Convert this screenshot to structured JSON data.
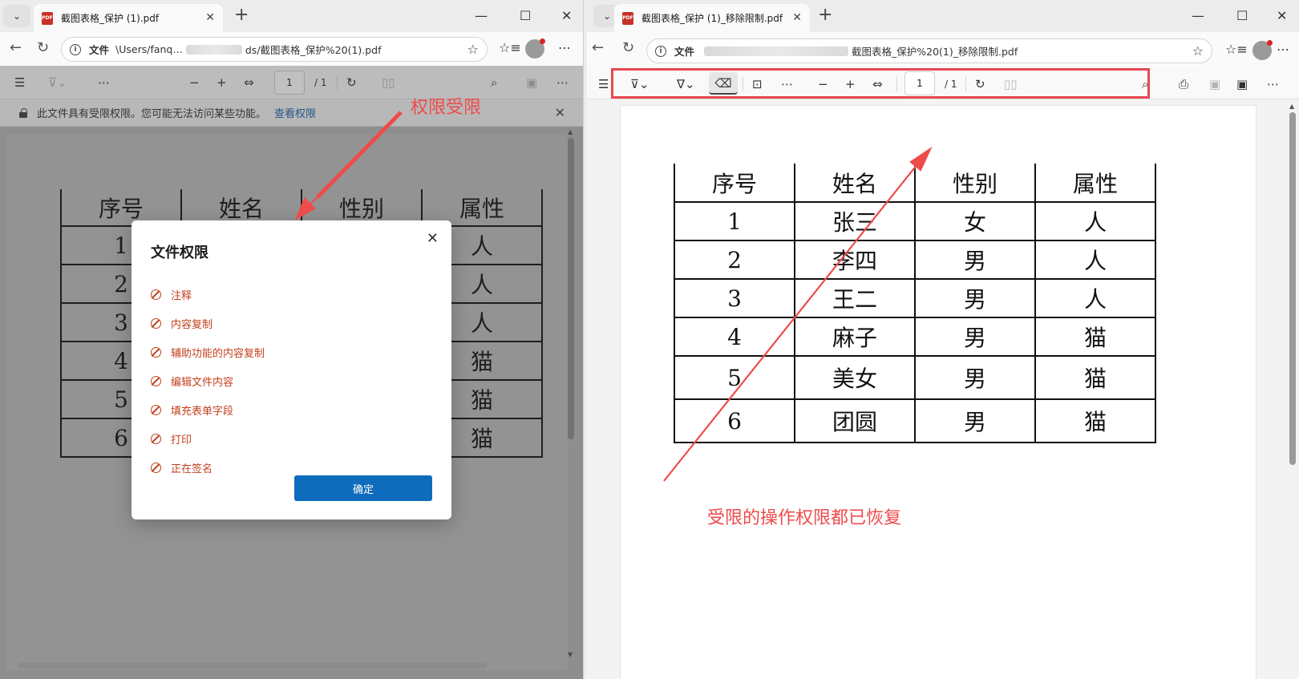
{
  "left_window": {
    "tab_title": "截图表格_保护 (1).pdf",
    "tab_close": "✕",
    "new_tab": "+",
    "window_controls": {
      "minimize": "—",
      "maximize": "☐",
      "close": "✕"
    },
    "address": {
      "scheme_label": "文件",
      "path_visible_start": "\\Users/fanq…",
      "path_visible_end": "ds/截图表格_保护%20(1).pdf"
    },
    "pdf_toolbar": {
      "page_current": "1",
      "page_total": "/ 1"
    },
    "restriction_bar": {
      "message": "此文件具有受限权限。您可能无法访问某些功能。",
      "link": "查看权限",
      "close": "✕"
    },
    "table": {
      "headers": [
        "序号",
        "姓名",
        "性别",
        "属性"
      ],
      "rows": [
        [
          "1",
          "",
          "",
          "人"
        ],
        [
          "2",
          "",
          "",
          "人"
        ],
        [
          "3",
          "",
          "",
          "人"
        ],
        [
          "4",
          "",
          "",
          "猫"
        ],
        [
          "5",
          "",
          "",
          "猫"
        ],
        [
          "6",
          "",
          "",
          "猫"
        ]
      ]
    },
    "dialog": {
      "title": "文件权限",
      "close": "✕",
      "permissions": [
        "注释",
        "内容复制",
        "辅助功能的内容复制",
        "编辑文件内容",
        "填充表单字段",
        "打印",
        "正在签名"
      ],
      "ok_button": "确定"
    }
  },
  "right_window": {
    "tab_title": "截图表格_保护 (1)_移除限制.pdf",
    "tab_close": "✕",
    "new_tab": "+",
    "window_controls": {
      "minimize": "—",
      "maximize": "☐",
      "close": "✕"
    },
    "address": {
      "scheme_label": "文件",
      "path_visible_end": "截图表格_保护%20(1)_移除限制.pdf"
    },
    "pdf_toolbar": {
      "page_current": "1",
      "page_total": "/ 1"
    },
    "table": {
      "headers": [
        "序号",
        "姓名",
        "性别",
        "属性"
      ],
      "rows": [
        [
          "1",
          "张三",
          "女",
          "人"
        ],
        [
          "2",
          "李四",
          "男",
          "人"
        ],
        [
          "3",
          "王二",
          "男",
          "人"
        ],
        [
          "4",
          "麻子",
          "男",
          "猫"
        ],
        [
          "5",
          "美女",
          "男",
          "猫"
        ],
        [
          "6",
          "团圆",
          "男",
          "猫"
        ]
      ]
    }
  },
  "annotations": {
    "left_note": "权限受限",
    "right_note": "受限的操作权限都已恢复",
    "color": "#ef4b4b"
  },
  "icons": {
    "back": "back-arrow-icon",
    "refresh": "refresh-icon",
    "favorite": "star-icon",
    "favorites_list": "favorites-list-icon",
    "menu": "more-icon",
    "contents": "contents-icon",
    "highlight": "highlighter-icon",
    "draw": "draw-icon",
    "erase": "eraser-icon",
    "text": "text-box-icon",
    "zoom_out": "minus-icon",
    "zoom_in": "plus-icon",
    "fit": "fit-page-icon",
    "rotate": "rotate-icon",
    "two_page": "page-view-icon",
    "search": "search-icon",
    "print": "print-icon",
    "save": "save-icon",
    "save_as": "save-as-icon",
    "lock": "lock-icon",
    "ban": "prohibited-icon"
  }
}
